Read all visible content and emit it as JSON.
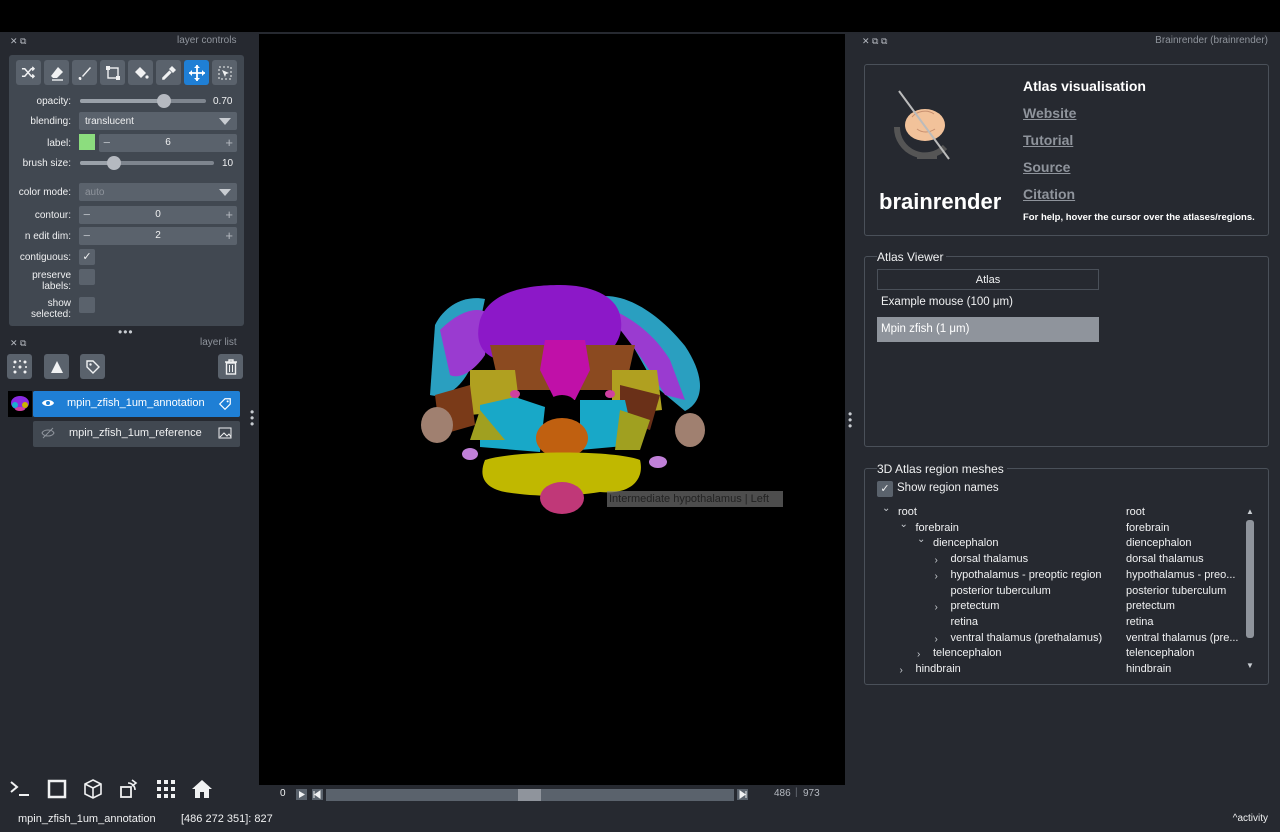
{
  "layer_controls": {
    "title": "layer controls",
    "opacity": {
      "label": "opacity:",
      "value": "0.70",
      "level": 0.7
    },
    "blending": {
      "label": "blending:",
      "value": "translucent"
    },
    "label": {
      "label": "label:",
      "value": "6",
      "swatch_color": "#8cdd7e"
    },
    "brush_size": {
      "label": "brush size:",
      "value": "10",
      "level": 0.3
    },
    "color_mode": {
      "label": "color mode:",
      "value": "auto"
    },
    "contour": {
      "label": "contour:",
      "value": "0"
    },
    "n_edit_dim": {
      "label": "n edit dim:",
      "value": "2"
    },
    "contiguous": {
      "label": "contiguous:",
      "checked": true
    },
    "preserve_labels": {
      "label_line1": "preserve",
      "label_line2": "labels:",
      "checked": false
    },
    "show_selected": {
      "label_line1": "show",
      "label_line2": "selected:",
      "checked": false
    },
    "tools": [
      "shuffle-icon",
      "eraser-icon",
      "paintbrush-icon",
      "polygon-icon",
      "fill-bucket-icon",
      "color-picker-icon",
      "pan-zoom-icon",
      "transform-icon"
    ],
    "active_tool": "pan-zoom-icon"
  },
  "layer_list": {
    "title": "layer list",
    "layers": [
      {
        "name": "mpin_zfish_1um_annotation",
        "selected": true,
        "visible": true
      },
      {
        "name": "mpin_zfish_1um_reference",
        "selected": false,
        "visible": false
      }
    ]
  },
  "dims": {
    "start": "0",
    "current": "486",
    "total": "973",
    "position": 0.5
  },
  "canvas": {
    "tooltip": "Intermediate hypothalamus | Left"
  },
  "status": {
    "layer": "mpin_zfish_1um_annotation",
    "coords": "[486 272 351]: 827",
    "activity": "activity"
  },
  "brainrender": {
    "dock_title": "Brainrender (brainrender)",
    "logo_text": "brainrender",
    "header": "Atlas visualisation",
    "links": [
      "Website",
      "Tutorial",
      "Source",
      "Citation"
    ],
    "help": "For help, hover the cursor over the atlases/regions.",
    "atlas_viewer": {
      "title": "Atlas Viewer",
      "column": "Atlas",
      "atlases": [
        "Example mouse (100 μm)",
        "Mpin zfish (1 μm)"
      ],
      "selected_index": 1
    },
    "meshes": {
      "title": "3D Atlas region meshes",
      "show_names_label": "Show region names",
      "show_names_checked": true,
      "tree": [
        {
          "name": "root",
          "col2": "root",
          "depth": 0,
          "expander": "open"
        },
        {
          "name": "forebrain",
          "col2": "forebrain",
          "depth": 1,
          "expander": "open"
        },
        {
          "name": "diencephalon",
          "col2": "diencephalon",
          "depth": 2,
          "expander": "open"
        },
        {
          "name": "dorsal thalamus",
          "col2": "dorsal thalamus",
          "depth": 3,
          "expander": "closed"
        },
        {
          "name": "hypothalamus - preoptic region",
          "col2": "hypothalamus - preo...",
          "depth": 3,
          "expander": "closed"
        },
        {
          "name": "posterior tuberculum",
          "col2": "posterior tuberculum",
          "depth": 3,
          "expander": "none"
        },
        {
          "name": "pretectum",
          "col2": "pretectum",
          "depth": 3,
          "expander": "closed"
        },
        {
          "name": "retina",
          "col2": "retina",
          "depth": 3,
          "expander": "none"
        },
        {
          "name": "ventral thalamus (prethalamus)",
          "col2": "ventral thalamus (pre...",
          "depth": 3,
          "expander": "closed"
        },
        {
          "name": "telencephalon",
          "col2": "telencephalon",
          "depth": 2,
          "expander": "closed"
        },
        {
          "name": "hindbrain",
          "col2": "hindbrain",
          "depth": 1,
          "expander": "closed"
        }
      ]
    }
  },
  "colors": {
    "accent": "#1f7fd5",
    "bg": "#262930",
    "panel": "#414851"
  }
}
